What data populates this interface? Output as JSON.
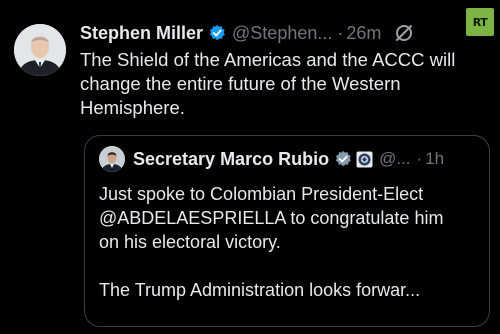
{
  "author": {
    "name": "Stephen Miller",
    "handle": "@Stephen...",
    "separator": "·",
    "time": "26m"
  },
  "post": {
    "line1": "The Shield of the Americas and the ACCC will",
    "line2": "change the entire future of the Western",
    "line3": "Hemisphere."
  },
  "quoted": {
    "name": "Secretary Marco Rubio",
    "handle": "@...",
    "separator": "·",
    "time": "1h",
    "line1": "Just spoke to Colombian President-Elect",
    "line2": "@ABDELAESPRIELLA to congratulate him",
    "line3": "on his electoral victory.",
    "line4": "The Trump Administration looks forwar..."
  },
  "watermark": {
    "text": "RT",
    "color": "#7cb342"
  },
  "icons": {
    "verified": "verified-badge-icon",
    "government": "government-badge-icon",
    "grok": "grok-icon",
    "seal": "seal-badge-icon"
  },
  "colors": {
    "background": "#000000",
    "text": "#e7e9ea",
    "muted": "#71767b",
    "verified_blue": "#1d9bf0",
    "government_gray": "#829aab",
    "quote_border": "#3a3d42"
  }
}
